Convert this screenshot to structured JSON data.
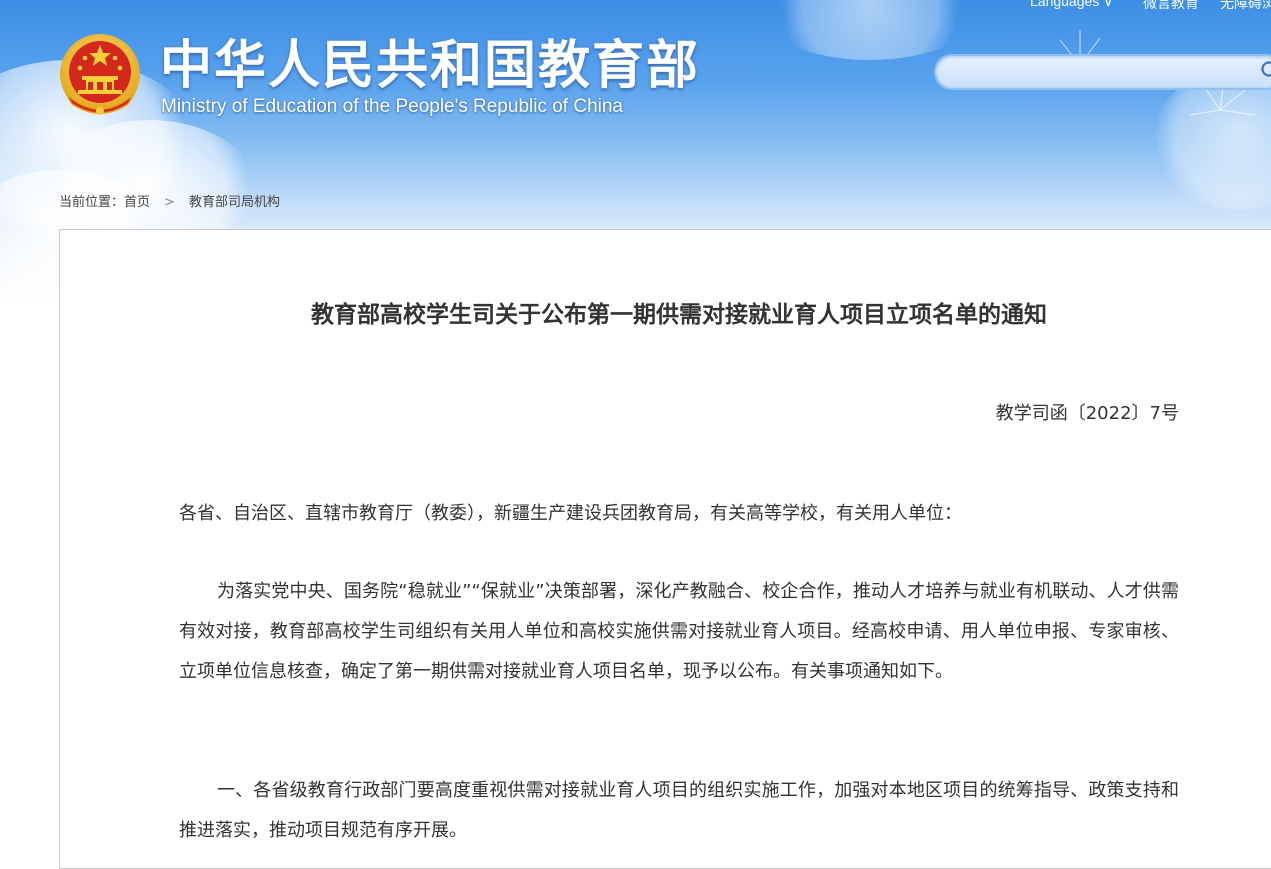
{
  "header": {
    "title": "中华人民共和国教育部",
    "subtitle": "Ministry of Education of the People's Republic of China",
    "top_links": [
      "Languages ∨",
      "微言教育",
      "无障碍浏"
    ],
    "search": {
      "placeholder": ""
    },
    "colors": {
      "sky_top": "#3d8ee6",
      "emblem_red": "#d4281c",
      "emblem_gold": "#f2c230"
    }
  },
  "breadcrumb": {
    "label": "当前位置：",
    "home": "首页",
    "separator": ">",
    "current": "教育部司局机构"
  },
  "article": {
    "title": "教育部高校学生司关于公布第一期供需对接就业育人项目立项名单的通知",
    "doc_number": "教学司函〔2022〕7号",
    "addressee": "各省、自治区、直辖市教育厅（教委），新疆生产建设兵团教育局，有关高等学校，有关用人单位：",
    "paragraph1": "为落实党中央、国务院“稳就业”“保就业”决策部署，深化产教融合、校企合作，推动人才培养与就业有机联动、人才供需有效对接，教育部高校学生司组织有关用人单位和高校实施供需对接就业育人项目。经高校申请、用人单位申报、专家审核、立项单位信息核查，确定了第一期供需对接就业育人项目名单，现予以公布。有关事项通知如下。",
    "paragraph2": "一、各省级教育行政部门要高度重视供需对接就业育人项目的组织实施工作，加强对本地区项目的统筹指导、政策支持和推进落实，推动项目规范有序开展。"
  }
}
